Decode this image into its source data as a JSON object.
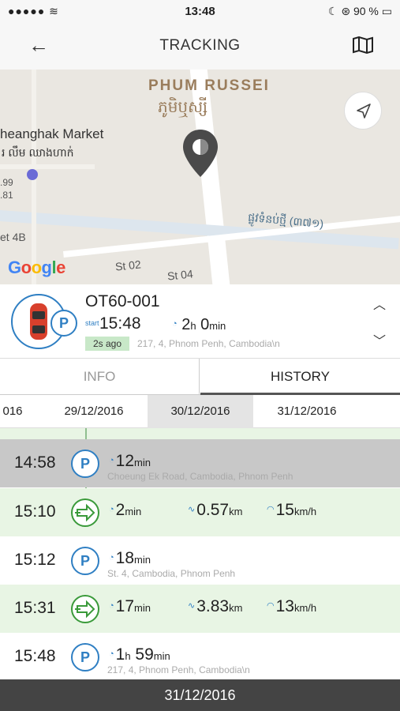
{
  "status": {
    "dots": "●●●●●",
    "time": "13:48",
    "battery": "90 %"
  },
  "nav": {
    "title": "TRACKING"
  },
  "map": {
    "district": "PHUM RUSSEI",
    "district_kh": "ភូមិឬស្សី",
    "market": "heanghak Market",
    "market_kh": "រ លឹម ឈាងហាក់",
    "price1": ".99",
    "price2": ".81",
    "road_kh": "ផ្លូវទំនប់ថ្មី (៣៧១)",
    "label_4b": "et 4B",
    "st02": "St 02",
    "st04": "St 04",
    "google": "Google"
  },
  "vehicle": {
    "name": "OT60-001",
    "start_label": "start",
    "start_time": "15:48",
    "duration_h": "2",
    "duration_h_unit": "h",
    "duration_m": "0",
    "duration_m_unit": "min",
    "ago": "2s ago",
    "address": "217, 4, Phnom Penh, Cambodia\\n"
  },
  "tabs": {
    "info": "INFO",
    "history": "HISTORY"
  },
  "dates": [
    "016",
    "29/12/2016",
    "30/12/2016",
    "31/12/2016"
  ],
  "history": [
    {
      "time": "14:58",
      "type": "park",
      "duration": "12",
      "unit": "min",
      "address": "Choeung Ek Road, Cambodia, Phnom Penh"
    },
    {
      "time": "15:10",
      "type": "move",
      "duration": "2",
      "unit": "min",
      "distance": "0.57",
      "dist_unit": "km",
      "speed": "15",
      "speed_unit": "km/h"
    },
    {
      "time": "15:12",
      "type": "park",
      "duration": "18",
      "unit": "min",
      "address": "St. 4, Cambodia, Phnom Penh"
    },
    {
      "time": "15:31",
      "type": "move",
      "duration": "17",
      "unit": "min",
      "distance": "3.83",
      "dist_unit": "km",
      "speed": "13",
      "speed_unit": "km/h"
    },
    {
      "time": "15:48",
      "type": "park",
      "duration_h": "1",
      "h_unit": "h",
      "duration": "59",
      "unit": "min",
      "address": "217, 4, Phnom Penh, Cambodia\\n"
    }
  ],
  "footer": {
    "date": "31/12/2016"
  },
  "colors": {
    "accent": "#2f7fc3",
    "move_green": "#3a9a3a",
    "highlight": "#c8c8c8",
    "move_bg": "#e8f5e4"
  }
}
